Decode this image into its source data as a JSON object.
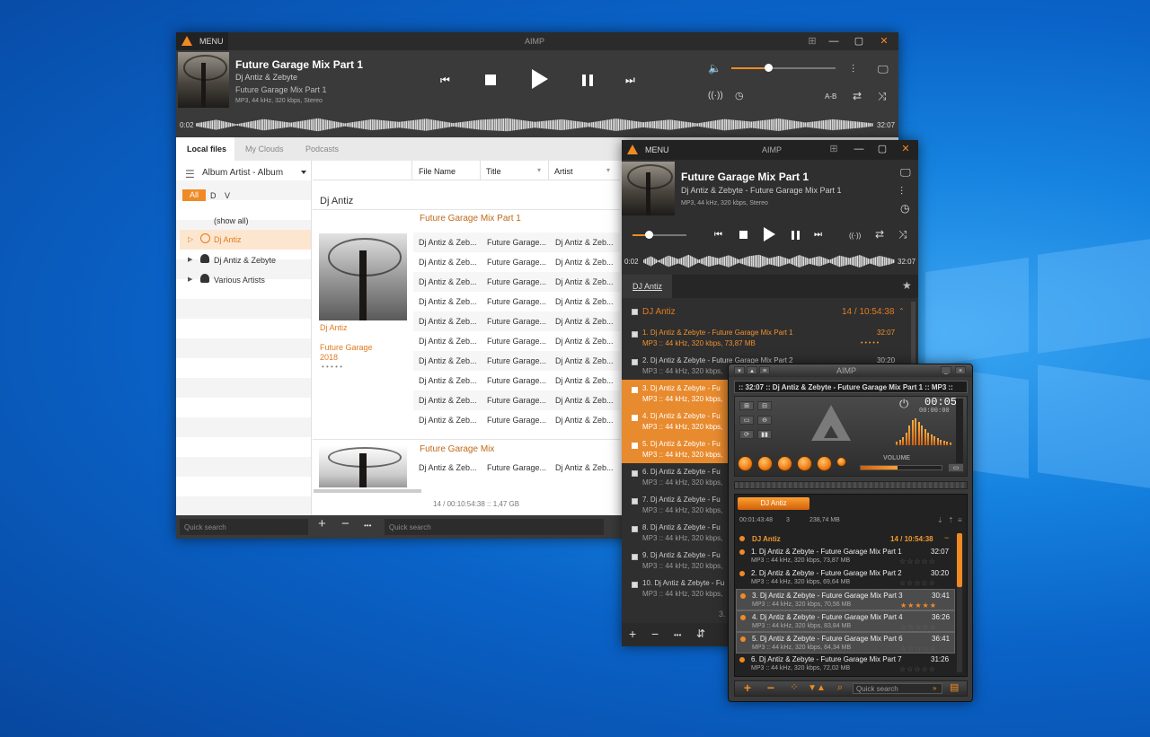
{
  "win1": {
    "menu": "MENU",
    "title": "AIMP",
    "track": {
      "title": "Future Garage Mix Part 1",
      "artist": "Dj Antiz & Zebyte",
      "album": "Future Garage Mix Part 1",
      "info": "MP3, 44 kHz, 320 kbps, Stereo"
    },
    "time_start": "0:02",
    "time_end": "32:07",
    "ab": "A-B",
    "volume": 0.35,
    "tabs": [
      "Local files",
      "My Clouds",
      "Podcasts"
    ],
    "group_by": "Album Artist - Album",
    "filters": [
      "All",
      "D",
      "V"
    ],
    "tree": [
      {
        "label": "(show all)"
      },
      {
        "label": "Dj Antiz"
      },
      {
        "label": "Dj Antiz & Zebyte"
      },
      {
        "label": "Various Artists"
      }
    ],
    "columns": [
      "File Name",
      "Title",
      "Artist"
    ],
    "group_name": "Dj Antiz",
    "album1": "Future Garage Mix Part 1",
    "album_meta": {
      "artist": "Dj Antiz",
      "genre": "Future Garage",
      "year": "2018",
      "dots": "• • • • •"
    },
    "rows_cell": [
      "Dj Antiz & Zeb...",
      "Future Garage...",
      "Dj Antiz & Zeb..."
    ],
    "album2": "Future Garage Mix",
    "footer": "14 / 00:10:54:38 :: 1,47 GB",
    "search_placeholder": "Quick search",
    "search2_placeholder": "Quick search",
    "toolbar": {
      "add": "+",
      "remove": "−",
      "more": "•••"
    }
  },
  "win2": {
    "menu": "MENU",
    "title": "AIMP",
    "track": {
      "title": "Future Garage Mix Part 1",
      "artist": "Dj Antiz & Zebyte - Future Garage Mix Part 1",
      "info": "MP3, 44 kHz, 320 kbps, Stereo"
    },
    "time_start": "0:02",
    "time_end": "32:07",
    "volume": 0.3,
    "tab": "DJ Antiz",
    "group": "DJ Antiz",
    "group_info": "14 / 10:54:38",
    "items": [
      {
        "title": "1. Dj Antiz & Zebyte - Future Garage Mix Part 1",
        "meta": "MP3 :: 44 kHz, 320 kbps, 73,87 MB",
        "dur": "32:07",
        "state": "playing"
      },
      {
        "title": "2. Dj Antiz & Zebyte - Future Garage Mix Part 2",
        "meta": "MP3 :: 44 kHz, 320 kbps,",
        "dur": "30:20",
        "state": ""
      },
      {
        "title": "3. Dj Antiz & Zebyte - Fu",
        "meta": "MP3 :: 44 kHz, 320 kbps,",
        "dur": "",
        "state": "selected"
      },
      {
        "title": "4. Dj Antiz & Zebyte - Fu",
        "meta": "MP3 :: 44 kHz, 320 kbps,",
        "dur": "",
        "state": "selected"
      },
      {
        "title": "5. Dj Antiz & Zebyte - Fu",
        "meta": "MP3 :: 44 kHz, 320 kbps,",
        "dur": "",
        "state": "selected"
      },
      {
        "title": "6. Dj Antiz & Zebyte - Fu",
        "meta": "MP3 :: 44 kHz, 320 kbps,",
        "dur": "",
        "state": ""
      },
      {
        "title": "7. Dj Antiz & Zebyte - Fu",
        "meta": "MP3 :: 44 kHz, 320 kbps,",
        "dur": "",
        "state": ""
      },
      {
        "title": "8. Dj Antiz & Zebyte - Fu",
        "meta": "MP3 :: 44 kHz, 320 kbps,",
        "dur": "",
        "state": ""
      },
      {
        "title": "9. Dj Antiz & Zebyte - Fu",
        "meta": "MP3 :: 44 kHz, 320 kbps,",
        "dur": "",
        "state": ""
      },
      {
        "title": "10. Dj Antiz & Zebyte - Fu",
        "meta": "MP3 :: 44 kHz, 320 kbps,",
        "dur": "",
        "state": ""
      }
    ],
    "footer_partial": "3."
  },
  "win3": {
    "title": "AIMP",
    "marquee": ":: 32:07 :: Dj Antiz & Zebyte - Future Garage Mix Part 1 :: MP3 ::",
    "time": "00:05",
    "time_small": "00:00:00",
    "volume_label": "VOLUME",
    "volume": 0.45,
    "playlist_tab": "DJ Antiz",
    "stats": {
      "time": "00:01:43:48",
      "count": "3",
      "size": "238,74 MB"
    },
    "group": "DJ Antiz",
    "group_info": "14 / 10:54:38",
    "items": [
      {
        "title": "1. Dj Antiz & Zebyte - Future Garage Mix Part 1",
        "dur": "32:07",
        "meta": "MP3 :: 44 kHz, 320 kbps, 73,87 MB",
        "state": ""
      },
      {
        "title": "2. Dj Antiz & Zebyte - Future Garage Mix Part 2",
        "dur": "30:20",
        "meta": "MP3 :: 44 kHz, 320 kbps, 69,64 MB",
        "state": ""
      },
      {
        "title": "3. Dj Antiz & Zebyte - Future Garage Mix Part 3",
        "dur": "30:41",
        "meta": "MP3 :: 44 kHz, 320 kbps, 70,56 MB",
        "state": "sel",
        "stars": "★★★★★"
      },
      {
        "title": "4. Dj Antiz & Zebyte - Future Garage Mix Part 4",
        "dur": "36:26",
        "meta": "MP3 :: 44 kHz, 320 kbps, 83,84 MB",
        "state": "sel"
      },
      {
        "title": "5. Dj Antiz & Zebyte - Future Garage Mix Part 6",
        "dur": "36:41",
        "meta": "MP3 :: 44 kHz, 320 kbps, 84,34 MB",
        "state": "sel"
      },
      {
        "title": "6. Dj Antiz & Zebyte - Future Garage Mix Part 7",
        "dur": "31:26",
        "meta": "MP3 :: 44 kHz, 320 kbps, 72,02 MB",
        "state": ""
      }
    ],
    "search_placeholder": "Quick search"
  }
}
